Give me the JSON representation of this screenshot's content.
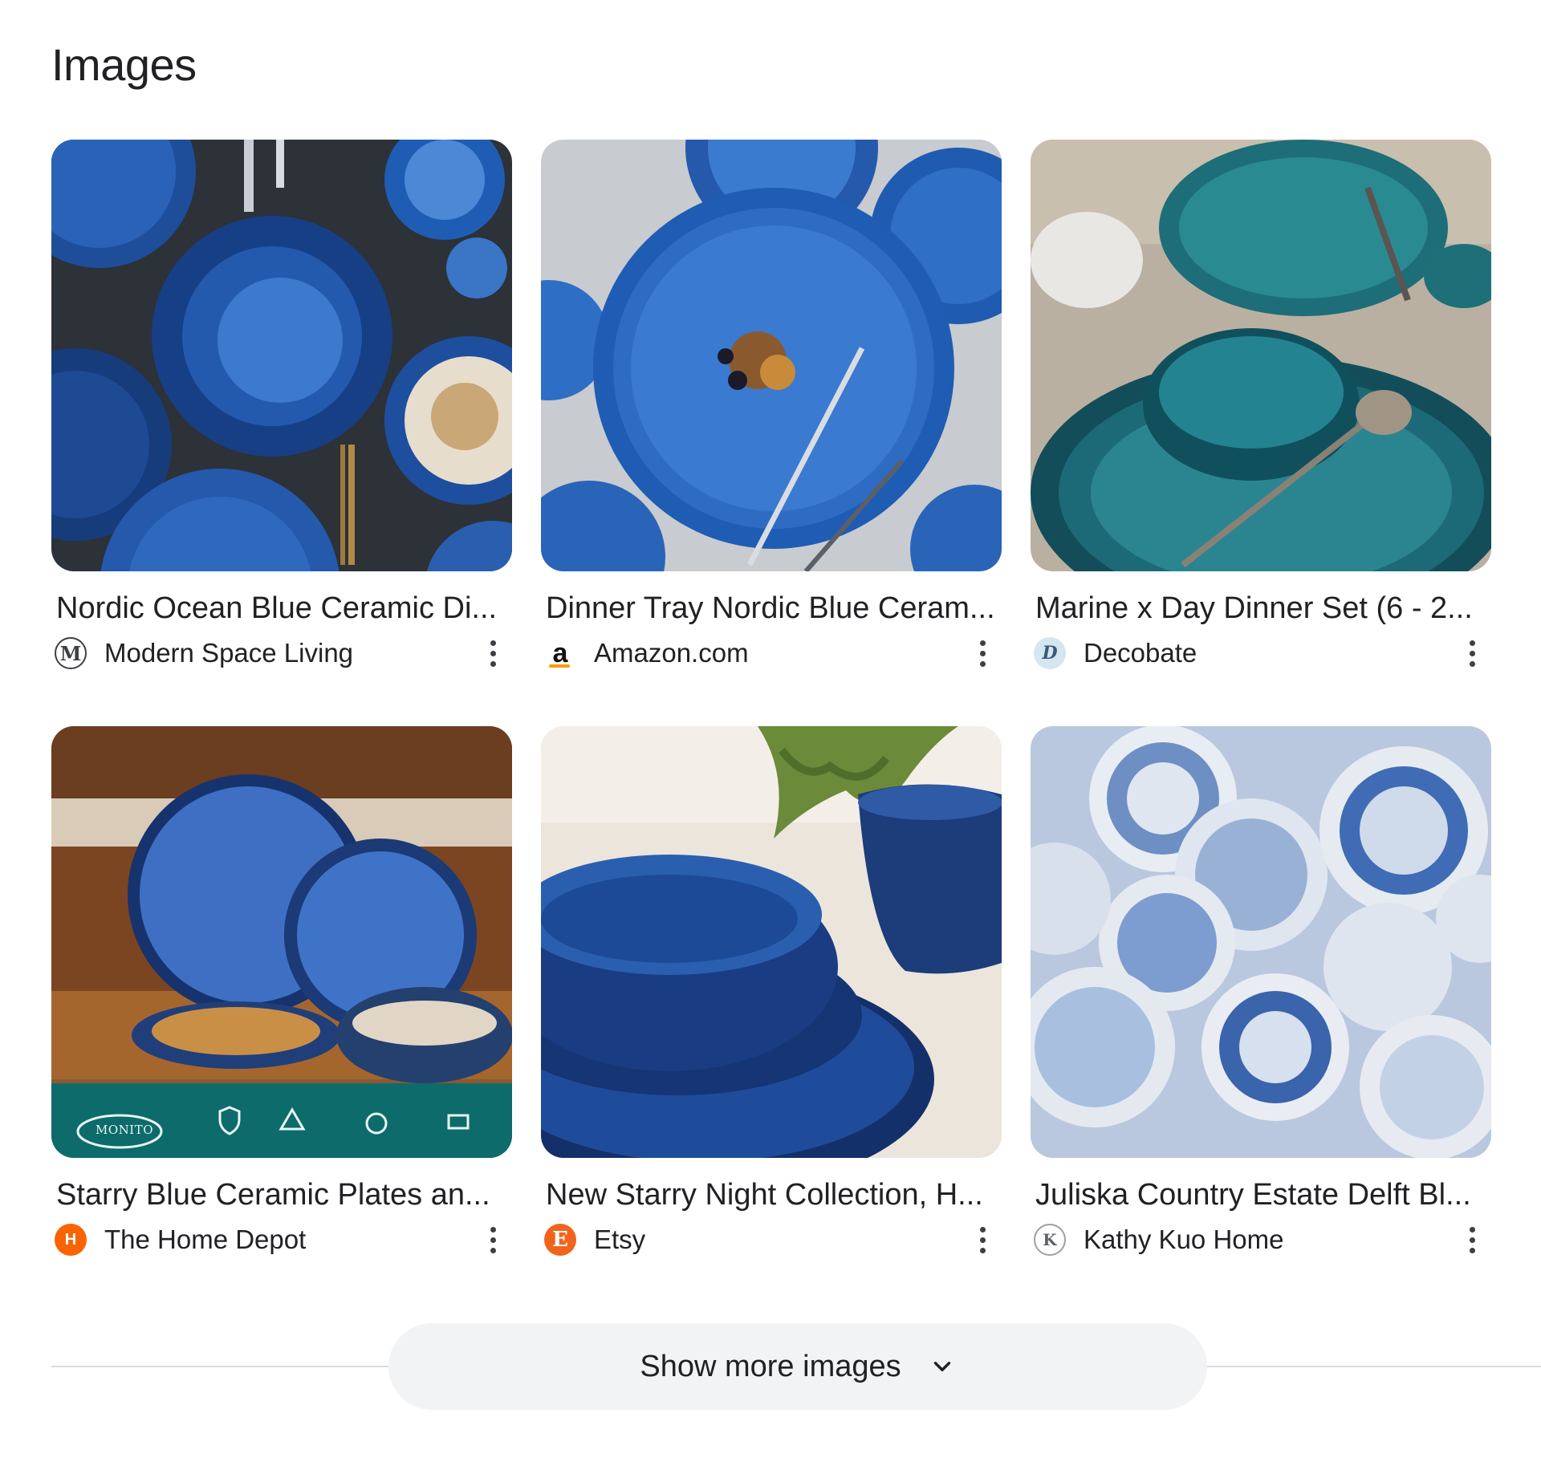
{
  "section": {
    "title": "Images"
  },
  "results": [
    {
      "title": "Nordic Ocean Blue Ceramic Di...",
      "source": "Modern Space Living",
      "favicon": "M",
      "favicon_icon": "modern-space-living-icon"
    },
    {
      "title": "Dinner Tray Nordic Blue Ceram...",
      "source": "Amazon.com",
      "favicon": "a",
      "favicon_icon": "amazon-icon"
    },
    {
      "title": "Marine x Day Dinner Set (6 - 2...",
      "source": "Decobate",
      "favicon": "D",
      "favicon_icon": "decobate-icon"
    },
    {
      "title": "Starry Blue Ceramic Plates an...",
      "source": "The Home Depot",
      "favicon": "H",
      "favicon_icon": "home-depot-icon"
    },
    {
      "title": "New Starry Night Collection, H...",
      "source": "Etsy",
      "favicon": "E",
      "favicon_icon": "etsy-icon"
    },
    {
      "title": "Juliska Country Estate Delft Bl...",
      "source": "Kathy Kuo Home",
      "favicon": "K",
      "favicon_icon": "kathy-kuo-home-icon"
    }
  ],
  "thumbnail_text": {
    "brand": "MONITO"
  },
  "show_more": {
    "label": "Show more images"
  },
  "colors": {
    "text": "#202124",
    "button_bg": "#f1f3f4",
    "divider": "#dadce0",
    "amazon": "#ff9900",
    "home_depot": "#f96302",
    "etsy": "#f1641e"
  }
}
